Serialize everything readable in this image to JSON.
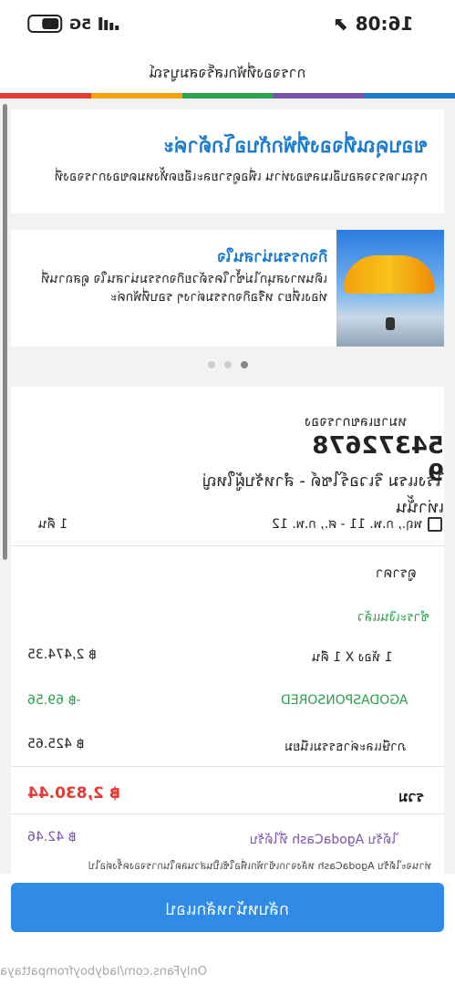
{
  "status_bar": {
    "time": "16:08 ⬈",
    "network": "5G"
  },
  "header": {
    "title": "การจองที่พักเสร็จสมบูรณ์"
  },
  "rainbow_colors": [
    "#e53935",
    "#f6a10d",
    "#2ea44f",
    "#7b52ab",
    "#1b7bd0"
  ],
  "thanks_card": {
    "title": "ขอบคุณที่จองที่พักกับอโกด้าค่ะ",
    "subtitle": "กรุณาตรวจสอบอีเมลของท่าน เพื่อดูรายละเอียดทั้งหมดของการจองที่"
  },
  "promo_card": {
    "title": "กิจกรรมน่าสนใจ",
    "text": "เดินทางสนุกไม่ซ้ำใครด้วยกิจกรรมน่าสนใจ ดูสถานที่ท่องเที่ยว หรือกิจกรรมต่างๆ รอบที่พักค่ะ"
  },
  "carousel": {
    "count": 3,
    "active_index": 2
  },
  "booking": {
    "number_label": "หมายเลขการจอง",
    "number": "54372678 9",
    "hotel": "โรงแรม ริเวอร์ไซด์ - สำหรับผู้ใหญ่เท่านั้น",
    "dates": "พฤ., ก.พ. 11 - ศ., ก.พ. 12",
    "nights": "1 คืน",
    "price_section_title": "ดูราคา",
    "paid_status": "ชำระเงินแล้ว",
    "rows": [
      {
        "label": "1 ห้อง X 1 คืน",
        "value": "฿ 2,474.35"
      },
      {
        "label": "AGODASPONSORED",
        "value": "-฿ 69.56"
      },
      {
        "label": "ภาษีและค่าธรรมเนียม",
        "value": "฿ 425.65"
      }
    ],
    "total_label": "รวม",
    "total_value": "฿ 2,830.44",
    "cashback_label": "ได้รับ AgodaCash ที่ได้รับ",
    "cashback_value": "฿ 42.46",
    "note": "ท่านจะได้รับ AgodaCash หลังจากเข้าพักเพื่อใช้เป็นส่วนลดในการจองครั้งต่อไป"
  },
  "primary_action": {
    "label": "กลับหน้าหลักแอป"
  },
  "watermark": "OnlyFans.com/ladyboyfrompattaya"
}
